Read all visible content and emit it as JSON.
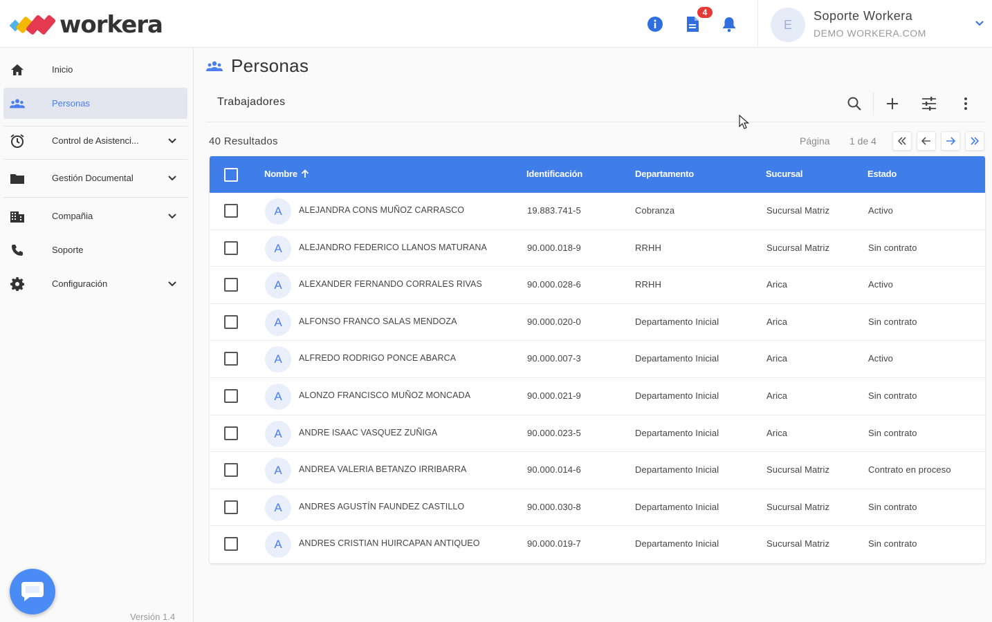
{
  "header": {
    "brand": "workera",
    "notification_count": "4",
    "user": {
      "initial": "E",
      "name": "Soporte Workera",
      "org": "DEMO WORKERA.COM"
    },
    "colors": {
      "info": "#2f6fdf",
      "docs": "#2f6fdf",
      "bell": "#2f6fdf",
      "badge": "#e53935"
    }
  },
  "sidebar": {
    "items": [
      {
        "label": "Inicio",
        "icon": "home-icon"
      },
      {
        "label": "Personas",
        "icon": "people-icon",
        "active": true
      },
      {
        "label": "Control de Asistenci...",
        "icon": "alarm-clock-icon",
        "expandable": true
      },
      {
        "label": "Gestión Documental",
        "icon": "folder-icon",
        "expandable": true
      },
      {
        "label": "Compañia",
        "icon": "building-icon",
        "expandable": true
      },
      {
        "label": "Soporte",
        "icon": "phone-icon"
      },
      {
        "label": "Configuración",
        "icon": "gear-icon",
        "expandable": true
      }
    ],
    "version": "Versión 1.4"
  },
  "main": {
    "title": "Personas",
    "search": {
      "value": "Trabajadores"
    },
    "results_label": "40 Resultados",
    "pagination": {
      "label": "Página",
      "value": "1 de 4"
    },
    "table": {
      "columns": [
        "Nombre",
        "Identificación",
        "Departamento",
        "Sucursal",
        "Estado"
      ],
      "rows": [
        {
          "initial": "A",
          "name": "ALEJANDRA CONS MUÑOZ CARRASCO",
          "id": "19.883.741-5",
          "dep": "Cobranza",
          "suc": "Sucursal Matriz",
          "est": "Activo"
        },
        {
          "initial": "A",
          "name": "ALEJANDRO FEDERICO LLANOS MATURANA",
          "id": "90.000.018-9",
          "dep": "RRHH",
          "suc": "Sucursal Matriz",
          "est": "Sin contrato"
        },
        {
          "initial": "A",
          "name": "ALEXANDER FERNANDO CORRALES RIVAS",
          "id": "90.000.028-6",
          "dep": "RRHH",
          "suc": "Arica",
          "est": "Activo"
        },
        {
          "initial": "A",
          "name": "ALFONSO FRANCO SALAS MENDOZA",
          "id": "90.000.020-0",
          "dep": "Departamento Inicial",
          "suc": "Arica",
          "est": "Sin contrato"
        },
        {
          "initial": "A",
          "name": "ALFREDO RODRIGO PONCE ABARCA",
          "id": "90.000.007-3",
          "dep": "Departamento Inicial",
          "suc": "Arica",
          "est": "Activo"
        },
        {
          "initial": "A",
          "name": "ALONZO FRANCISCO MUÑOZ MONCADA",
          "id": "90.000.021-9",
          "dep": "Departamento Inicial",
          "suc": "Arica",
          "est": "Sin contrato"
        },
        {
          "initial": "A",
          "name": "ANDRE ISAAC VASQUEZ ZUÑIGA",
          "id": "90.000.023-5",
          "dep": "Departamento Inicial",
          "suc": "Arica",
          "est": "Sin contrato"
        },
        {
          "initial": "A",
          "name": "ANDREA VALERIA BETANZO IRRIBARRA",
          "id": "90.000.014-6",
          "dep": "Departamento Inicial",
          "suc": "Sucursal Matriz",
          "est": "Contrato en proceso"
        },
        {
          "initial": "A",
          "name": "ANDRES AGUSTÍN FAUNDEZ CASTILLO",
          "id": "90.000.030-8",
          "dep": "Departamento Inicial",
          "suc": "Sucursal Matriz",
          "est": "Sin contrato"
        },
        {
          "initial": "A",
          "name": "ANDRES CRISTIAN HUIRCAPAN ANTIQUEO",
          "id": "90.000.019-7",
          "dep": "Departamento Inicial",
          "suc": "Sucursal Matriz",
          "est": "Sin contrato"
        }
      ]
    }
  },
  "colors": {
    "accent": "#3f7ee8",
    "active_bg": "#e3e6ee",
    "chat": "#4a8bf5"
  }
}
